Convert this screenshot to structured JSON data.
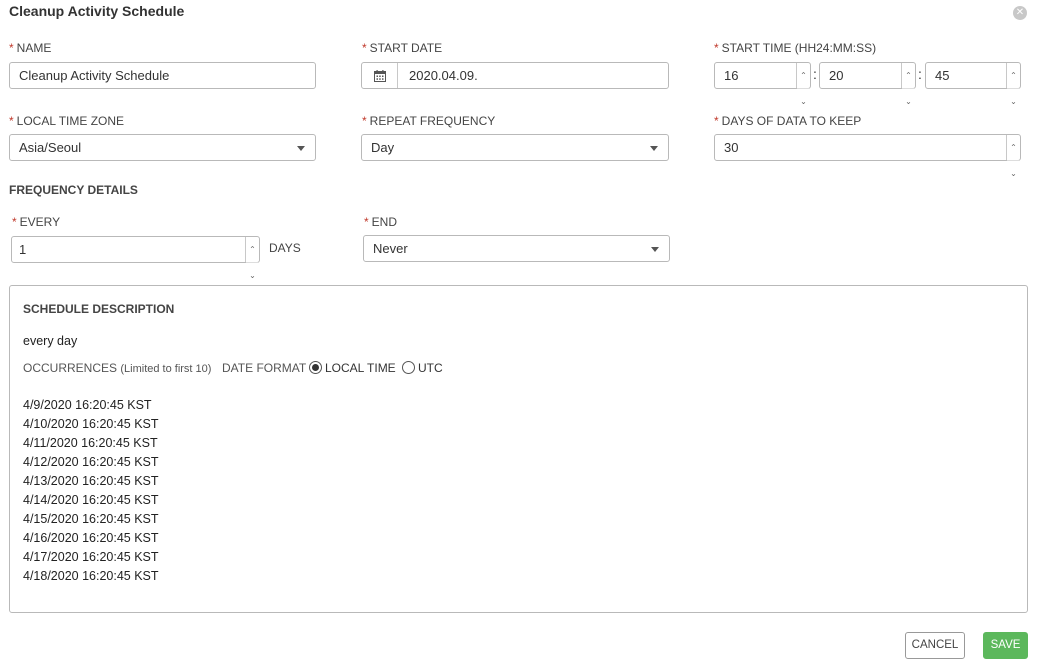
{
  "dialog": {
    "title": "Cleanup Activity Schedule",
    "close_glyph": "✕"
  },
  "fields": {
    "name": {
      "label": "NAME",
      "value": "Cleanup Activity Schedule"
    },
    "start_date": {
      "label": "START DATE",
      "value": "2020.04.09.",
      "icon": "calendar-icon"
    },
    "start_time": {
      "label": "START TIME (HH24:MM:SS)",
      "hours": "16",
      "minutes": "20",
      "seconds": "45",
      "separator": ":"
    },
    "local_time_zone": {
      "label": "LOCAL TIME ZONE",
      "value": "Asia/Seoul"
    },
    "repeat_frequency": {
      "label": "REPEAT FREQUENCY",
      "value": "Day"
    },
    "days_to_keep": {
      "label": "DAYS OF DATA TO KEEP",
      "value": "30"
    }
  },
  "required_mark": "*",
  "frequency_details": {
    "heading": "FREQUENCY DETAILS",
    "every": {
      "label": "EVERY",
      "value": "1",
      "unit": "DAYS"
    },
    "end": {
      "label": "END",
      "value": "Never"
    }
  },
  "schedule_description": {
    "heading": "SCHEDULE DESCRIPTION",
    "summary": "every day",
    "occurrences_label": "OCCURRENCES",
    "occurrences_note": "(Limited to first 10)",
    "date_format_label": "DATE FORMAT",
    "date_format_options": [
      {
        "label": "LOCAL TIME",
        "selected": true
      },
      {
        "label": "UTC",
        "selected": false
      }
    ],
    "occurrences": [
      "4/9/2020 16:20:45 KST",
      "4/10/2020 16:20:45 KST",
      "4/11/2020 16:20:45 KST",
      "4/12/2020 16:20:45 KST",
      "4/13/2020 16:20:45 KST",
      "4/14/2020 16:20:45 KST",
      "4/15/2020 16:20:45 KST",
      "4/16/2020 16:20:45 KST",
      "4/17/2020 16:20:45 KST",
      "4/18/2020 16:20:45 KST"
    ]
  },
  "buttons": {
    "cancel": "CANCEL",
    "save": "SAVE"
  },
  "colors": {
    "required": "#c0392b",
    "save": "#5cb85c",
    "border": "#b9b9b9"
  }
}
